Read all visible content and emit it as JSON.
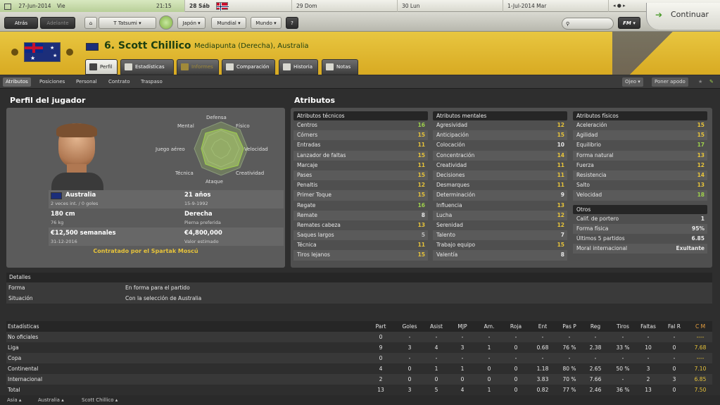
{
  "datebar": {
    "current_date": "27-Jun-2014",
    "current_day": "Vie",
    "time": "21:15",
    "d1": "28 Sáb",
    "d2": "29 Dom",
    "d3": "30 Lun",
    "d4": "1-Jul-2014 Mar"
  },
  "nav": {
    "back": "Atrás",
    "forward": "Adelante",
    "manager": "T Tatsumi",
    "japan": "Japón",
    "world_cup": "Mundial",
    "world": "Mundo",
    "continue": "Continuar",
    "fm": "FM"
  },
  "player": {
    "number_name": "6. Scott Chillico",
    "position": "Mediapunta (Derecha), Australia"
  },
  "tabs": {
    "profile": "Perfil",
    "stats": "Estadísticas",
    "reports": "Informes",
    "compare": "Comparación",
    "history": "Historia",
    "notes": "Notas"
  },
  "subnav": {
    "attributes": "Atributos",
    "positions": "Posiciones",
    "personal": "Personal",
    "contract": "Contrato",
    "transfer": "Traspaso",
    "scout": "Ojeo",
    "nickname": "Poner apodo"
  },
  "profile": {
    "title": "Perfil del jugador",
    "nation": "Australia",
    "caps": "2 veces int. / 0 goles",
    "age": "21 años",
    "dob": "15-9-1992",
    "height": "180 cm",
    "weight": "76 kg",
    "foot": "Derecha",
    "foot_lbl": "Pierna preferida",
    "wage": "€12,500 semanales",
    "contract_end": "31-12-2016",
    "value": "€4,800,000",
    "value_lbl": "Valor estimado",
    "contracted": "Contratado por el Spartak Moscú",
    "radar": {
      "defensa": "Defensa",
      "fisico": "Físico",
      "velocidad": "Velocidad",
      "creatividad": "Creatividad",
      "ataque": "Ataque",
      "tecnica": "Técnica",
      "juego_aereo": "Juego aéreo",
      "mental": "Mental"
    }
  },
  "attrs_title": "Atributos",
  "technical": {
    "title": "Atributos técnicos",
    "items": [
      [
        "Centros",
        "16"
      ],
      [
        "Córners",
        "15"
      ],
      [
        "Entradas",
        "11"
      ],
      [
        "Lanzador de faltas",
        "15"
      ],
      [
        "Marcaje",
        "11"
      ],
      [
        "Pases",
        "15"
      ],
      [
        "Penaltis",
        "12"
      ],
      [
        "Primer Toque",
        "15"
      ],
      [
        "Regate",
        "16"
      ],
      [
        "Remate",
        "8"
      ],
      [
        "Remates cabeza",
        "13"
      ],
      [
        "Saques largos",
        "5"
      ],
      [
        "Técnica",
        "11"
      ],
      [
        "Tiros lejanos",
        "15"
      ]
    ]
  },
  "mental": {
    "title": "Atributos mentales",
    "items": [
      [
        "Agresividad",
        "12"
      ],
      [
        "Anticipación",
        "15"
      ],
      [
        "Colocación",
        "10"
      ],
      [
        "Concentración",
        "14"
      ],
      [
        "Creatividad",
        "11"
      ],
      [
        "Decisiones",
        "11"
      ],
      [
        "Desmarques",
        "11"
      ],
      [
        "Determinación",
        "9"
      ],
      [
        "Influencia",
        "13"
      ],
      [
        "Lucha",
        "12"
      ],
      [
        "Serenidad",
        "12"
      ],
      [
        "Talento",
        "7"
      ],
      [
        "Trabajo equipo",
        "15"
      ],
      [
        "Valentía",
        "8"
      ]
    ]
  },
  "physical": {
    "title": "Atributos físicos",
    "items": [
      [
        "Aceleración",
        "15"
      ],
      [
        "Agilidad",
        "15"
      ],
      [
        "Equilibrio",
        "17"
      ],
      [
        "Forma natural",
        "13"
      ],
      [
        "Fuerza",
        "12"
      ],
      [
        "Resistencia",
        "14"
      ],
      [
        "Salto",
        "13"
      ],
      [
        "Velocidad",
        "18"
      ]
    ]
  },
  "others": {
    "title": "Otros",
    "items": [
      [
        "Calif. de portero",
        "1"
      ],
      [
        "Forma física",
        "95%"
      ],
      [
        "Últimos 5 partidos",
        "6.85"
      ],
      [
        "Moral internacional",
        "Exultante"
      ]
    ]
  },
  "details": {
    "title": "Detalles",
    "form_lbl": "Forma",
    "form": "En forma para el partido",
    "status_lbl": "Situación",
    "status": "Con la selección de Australia"
  },
  "stats": {
    "title": "Estadísticas",
    "cols": [
      "Part",
      "Goles",
      "Asist",
      "MJP",
      "Am.",
      "Roja",
      "Ent",
      "Pas P",
      "Reg",
      "Tiros",
      "Faltas",
      "Fal R",
      "C M"
    ],
    "rows": [
      {
        "name": "No oficiales",
        "v": [
          "0",
          "-",
          "-",
          "-",
          "-",
          "-",
          "-",
          "-",
          "-",
          "-",
          "-",
          "-",
          "----"
        ]
      },
      {
        "name": "Liga",
        "v": [
          "9",
          "3",
          "4",
          "3",
          "1",
          "0",
          "0.68",
          "76 %",
          "2.38",
          "33 %",
          "10",
          "0",
          "7.68"
        ]
      },
      {
        "name": "Copa",
        "v": [
          "0",
          "-",
          "-",
          "-",
          "-",
          "-",
          "-",
          "-",
          "-",
          "-",
          "-",
          "-",
          "----"
        ]
      },
      {
        "name": "Continental",
        "v": [
          "4",
          "0",
          "1",
          "1",
          "0",
          "0",
          "1.18",
          "80 %",
          "2.65",
          "50 %",
          "3",
          "0",
          "7.10"
        ]
      },
      {
        "name": "Internacional",
        "v": [
          "2",
          "0",
          "0",
          "0",
          "0",
          "0",
          "3.83",
          "70 %",
          "7.66",
          "-",
          "2",
          "3",
          "6.85"
        ]
      },
      {
        "name": "Total",
        "v": [
          "13",
          "3",
          "5",
          "4",
          "1",
          "0",
          "0.82",
          "77 %",
          "2.46",
          "36 %",
          "13",
          "0",
          "7.50"
        ]
      }
    ]
  },
  "footer": {
    "b1": "Asia",
    "b2": "Australia",
    "b3": "Scott Chillico"
  }
}
